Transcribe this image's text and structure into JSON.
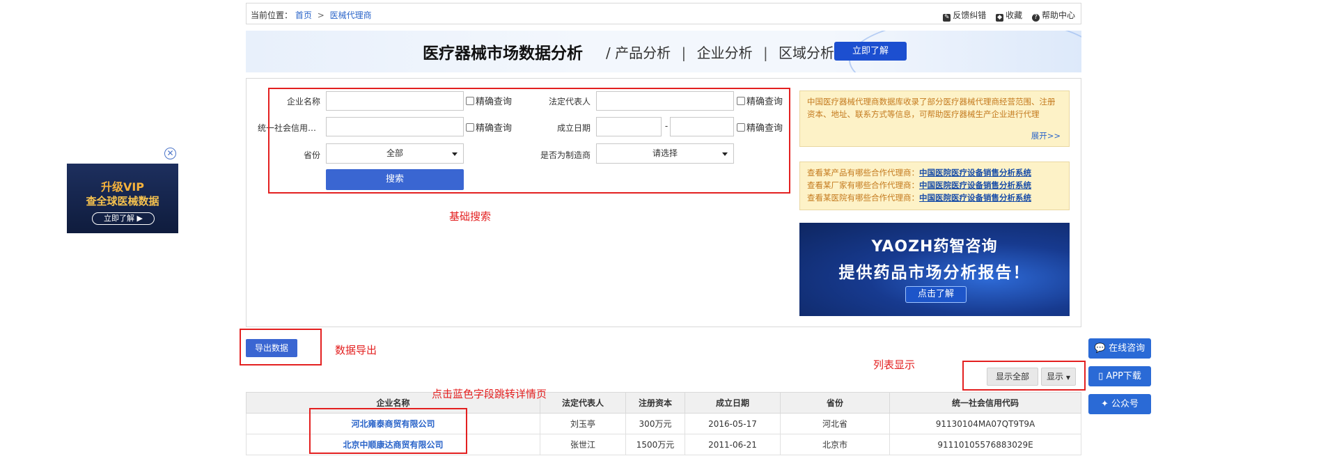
{
  "breadcrumb": {
    "prefix": "当前位置：",
    "home": "首页",
    "separator": ">",
    "current": "医械代理商",
    "feedback": "反馈纠错",
    "favorite": "收藏",
    "help": "帮助中心"
  },
  "banner": {
    "title": "医疗器械市场数据分析",
    "slash": "/",
    "sub1": "产品分析",
    "sub2": "企业分析",
    "sub3": "区域分析",
    "bar": "|",
    "cta": "立即了解"
  },
  "search": {
    "company_label": "企业名称",
    "company_value": "",
    "exact_label": "精确查询",
    "legal_label": "法定代表人",
    "legal_value": "",
    "credit_label": "统一社会信用…",
    "credit_value": "",
    "date_label": "成立日期",
    "date_sep": "-",
    "province_label": "省份",
    "province_value": "全部",
    "maker_label": "是否为制造商",
    "maker_value": "请选择",
    "search_button": "搜索"
  },
  "annotations": {
    "basic_search": "基础搜索",
    "export": "数据导出",
    "list_display": "列表显示",
    "click_blue": "点击蓝色字段跳转详情页"
  },
  "info1": {
    "text": "中国医疗器械代理商数据库收录了部分医疗器械代理商经营范围、注册资本、地址、联系方式等信息，可帮助医疗器械生产企业进行代理",
    "more": "展开>>"
  },
  "info2": {
    "rows": [
      {
        "prefix": "查看某产品有哪些合作代理商：",
        "link": "中国医院医疗设备销售分析系统"
      },
      {
        "prefix": "查看某厂家有哪些合作代理商：",
        "link": "中国医院医疗设备销售分析系统"
      },
      {
        "prefix": "查看某医院有哪些合作代理商：",
        "link": "中国医院医疗设备销售分析系统"
      }
    ]
  },
  "ad_big": {
    "brand": "YAOZH药智咨询",
    "main": "提供药品市场分析报告！",
    "button": "点击了解"
  },
  "ad_left": {
    "line1": "升级VIP",
    "line2": "查全球医械数据",
    "button": "立即了解 ▶"
  },
  "export_button": "导出数据",
  "list_controls": {
    "show_all": "显示全部",
    "show": "显示"
  },
  "float": {
    "consult": "在线咨询",
    "app": "APP下载",
    "wechat": "公众号"
  },
  "table": {
    "headers": [
      "企业名称",
      "法定代表人",
      "注册资本",
      "成立日期",
      "省份",
      "统一社会信用代码"
    ],
    "rows": [
      [
        "河北雍泰商贸有限公司",
        "刘玉亭",
        "300万元",
        "2016-05-17",
        "河北省",
        "91130104MA07QT9T9A"
      ],
      [
        "北京中顺康达商贸有限公司",
        "张世江",
        "1500万元",
        "2011-06-21",
        "北京市",
        "91110105576883029E"
      ]
    ]
  },
  "colors": {
    "accent_blue": "#3a66d2",
    "annotation_red": "#e32020",
    "info_bg": "#fdf2c7"
  }
}
